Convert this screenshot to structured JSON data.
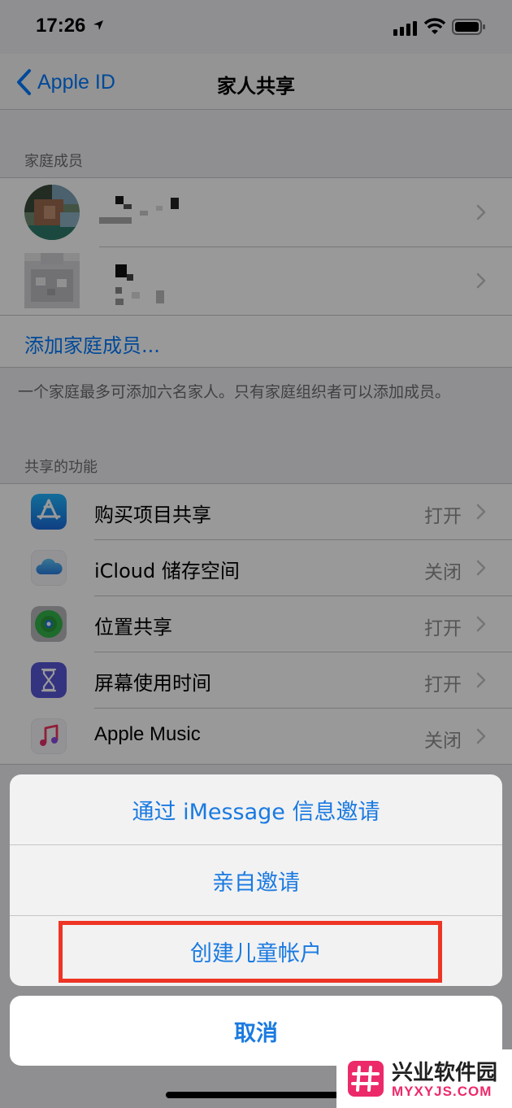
{
  "status_bar": {
    "time": "17:26"
  },
  "nav": {
    "back_label": "Apple ID",
    "title": "家人共享"
  },
  "family_section": {
    "header": "家庭成员",
    "add_member": "添加家庭成员...",
    "footnote": "一个家庭最多可添加六名家人。只有家庭组织者可以添加成员。"
  },
  "features_section": {
    "header": "共享的功能",
    "items": [
      {
        "label": "购买项目共享",
        "value": "打开",
        "icon": "app-store-icon"
      },
      {
        "label": "iCloud 储存空间",
        "value": "关闭",
        "icon": "icloud-icon"
      },
      {
        "label": "位置共享",
        "value": "打开",
        "icon": "find-my-icon"
      },
      {
        "label": "屏幕使用时间",
        "value": "打开",
        "icon": "screen-time-icon"
      },
      {
        "label": "Apple Music",
        "value": "关闭",
        "icon": "music-icon"
      }
    ]
  },
  "action_sheet": {
    "items": [
      "通过 iMessage 信息邀请",
      "亲自邀请",
      "创建儿童帐户"
    ],
    "cancel": "取消"
  },
  "colors": {
    "accent": "#007aff",
    "highlight": "#ee3524"
  },
  "watermark": {
    "title": "兴业软件园",
    "subtitle": "MYXYJS.COM"
  }
}
